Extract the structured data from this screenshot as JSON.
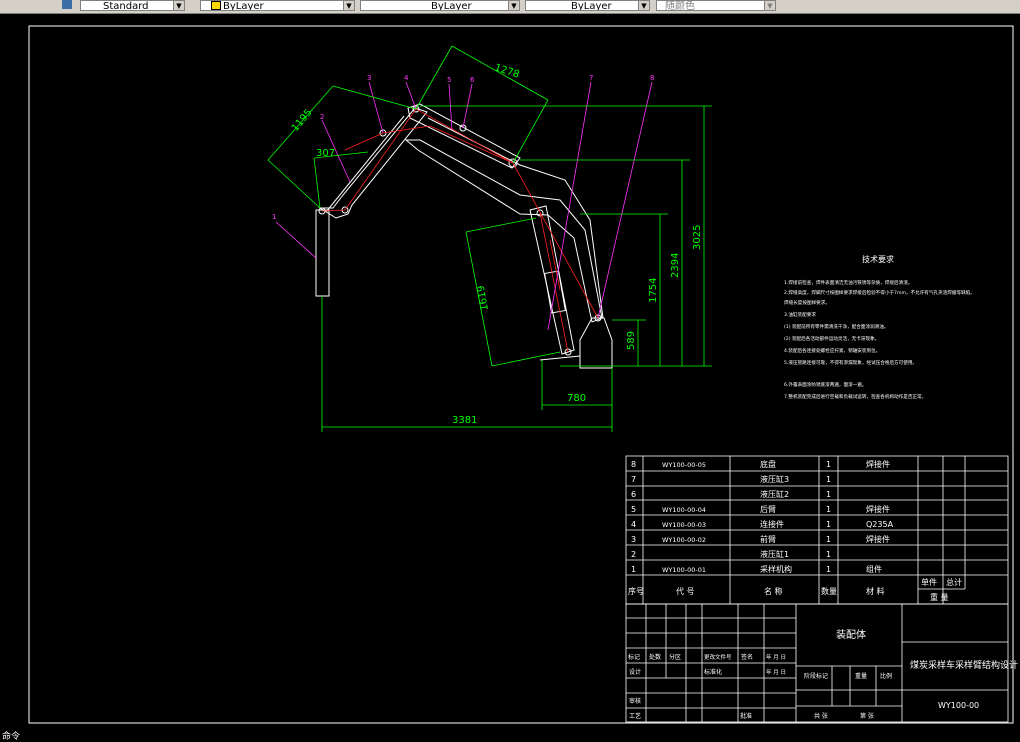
{
  "toolbar": {
    "text_style": "Standard",
    "layer": "ByLayer",
    "linetype": "ByLayer",
    "lineweight": "ByLayer",
    "plot_style": "随颜色"
  },
  "command_prompt": "命令",
  "colors": {
    "background": "#000000",
    "dimension": "#00ff00",
    "leader": "#ff00ff",
    "outline": "#ffffff",
    "hidden": "#ff0000"
  },
  "dimensions": {
    "d1195": "1195",
    "d307": "307",
    "d1278": "1278",
    "d3025": "3025",
    "d2394": "2394",
    "d1754": "1754",
    "d1619": "1619",
    "d589": "589",
    "d780": "780",
    "d3381": "3381"
  },
  "balloons": [
    "1",
    "2",
    "3",
    "4",
    "5",
    "6",
    "7",
    "8"
  ],
  "tech_requirements": {
    "title": "技术要求",
    "lines": [
      "1.焊接前检查，焊件表面清洁无油污铁锈等杂质，焊接后清渣。",
      "2.焊缝高度，焊脚尺寸按图样要求焊接后检验不得小于7mm，不允许有气孔夹渣焊瘤等缺陷。",
      "焊缝长度按图样要求。",
      "3.油缸装配要求",
      "(1) 装配前所有零件需清洗干净，配合面涂润滑油。",
      "(2) 装配后各活动部件运动灵活，无卡滞现象。",
      "4.装配后各连接处螺栓应拧紧，销轴安装到位。",
      "5.液压管路连接可靠，不得有渗漏现象，经试压合格后方可使用。",
      "6.外露表面涂防锈底漆两遍，面漆一遍。",
      "7.整机装配完成后进行空载和负载试运转，检查各机构动作是否正常。"
    ]
  },
  "parts_list": {
    "rows": [
      {
        "no": "8",
        "code": "WY100-00-05",
        "name": "底盘",
        "qty": "1",
        "material": "焊接件"
      },
      {
        "no": "7",
        "code": "",
        "name": "液压缸3",
        "qty": "1",
        "material": ""
      },
      {
        "no": "6",
        "code": "",
        "name": "液压缸2",
        "qty": "1",
        "material": ""
      },
      {
        "no": "5",
        "code": "WY100-00-04",
        "name": "后臂",
        "qty": "1",
        "material": "焊接件"
      },
      {
        "no": "4",
        "code": "WY100-00-03",
        "name": "连接件",
        "qty": "1",
        "material": "Q235A"
      },
      {
        "no": "3",
        "code": "WY100-00-02",
        "name": "前臂",
        "qty": "1",
        "material": "焊接件"
      },
      {
        "no": "2",
        "code": "",
        "name": "液压缸1",
        "qty": "1",
        "material": ""
      },
      {
        "no": "1",
        "code": "WY100-00-01",
        "name": "采样机构",
        "qty": "1",
        "material": "组件"
      }
    ],
    "header": {
      "no": "序号",
      "code": "代 号",
      "name": "名 称",
      "qty": "数量",
      "material": "材 料",
      "single": "单件",
      "total": "总计",
      "weight": "重 量"
    }
  },
  "title_block": {
    "drawing_name": "装配体",
    "project_title": "煤炭采样车采样臂结构设计",
    "drawing_number": "WY100-00",
    "mark": "标记",
    "count": "处数",
    "zone": "分区",
    "change_doc": "更改文件号",
    "signature": "签名",
    "date_header": "年 月 日",
    "design": "设计",
    "standardization": "标准化",
    "date": "年 月 日",
    "stage_mark": "阶段标记",
    "weight": "重量",
    "scale": "比例",
    "review": "审核",
    "process": "工艺",
    "approve": "批准",
    "sheets_total": "共 张",
    "sheet_no": "第 张"
  }
}
